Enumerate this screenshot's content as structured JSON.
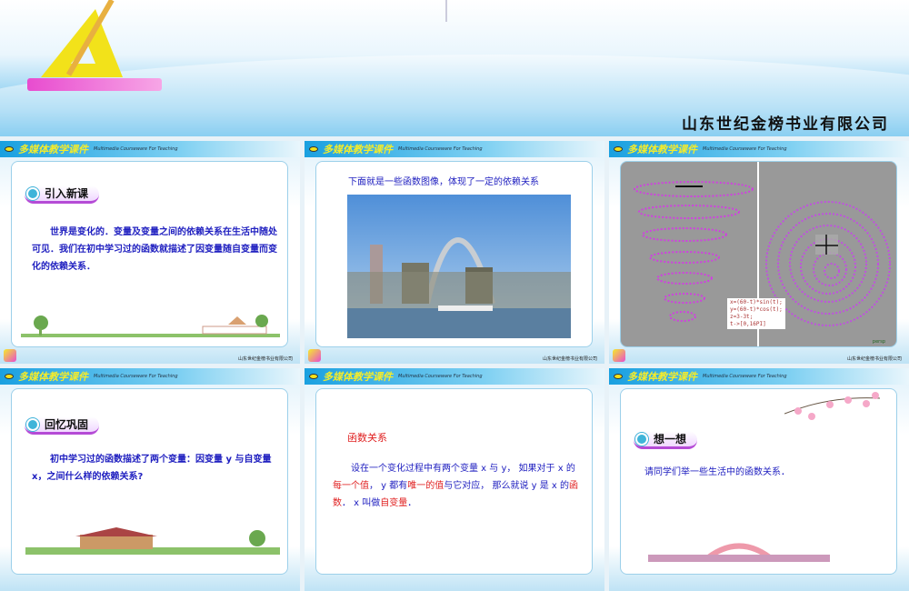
{
  "banner": {
    "company": "山东世纪金榜书业有限公司"
  },
  "slide_header": {
    "brand": "多媒体教学课件",
    "subtitle": "Multimedia Courseware For Teaching",
    "footer": "山东世纪金榜书业有限公司"
  },
  "slides": [
    {
      "badge": "引入新课",
      "text": "世界是变化的．变量及变量之间的依赖关系在生活中随处可见．我们在初中学习过的函数就描述了因变量随自变量而变化的依赖关系．"
    },
    {
      "caption": "下面就是一些函数图像，体现了一定的依赖关系"
    },
    {
      "formula": [
        "x=(60-t)*sin(t);",
        "y=(60-t)*cos(t);",
        "z=3-3t;",
        "t->[0,16PI]"
      ],
      "view_label": "persp"
    },
    {
      "badge": "回忆巩固",
      "text": "初中学习过的函数描述了两个变量：因变量 y 与自变量 x，之间什么样的依赖关系?"
    },
    {
      "heading": "函数关系",
      "p1": "设在一个变化过程中有两个变量 x 与 y， 如果对于 x 的",
      "h1": "每一个值",
      "p2": "， y 都有",
      "h2": "唯一的值",
      "p3": "与它对应， 那么就说 y 是 x 的",
      "h3": "函数",
      "p4": "． x 叫做",
      "h4": "自变量",
      "p5": "．"
    },
    {
      "badge": "想一想",
      "text": "请同学们举一些生活中的函数关系．"
    }
  ]
}
